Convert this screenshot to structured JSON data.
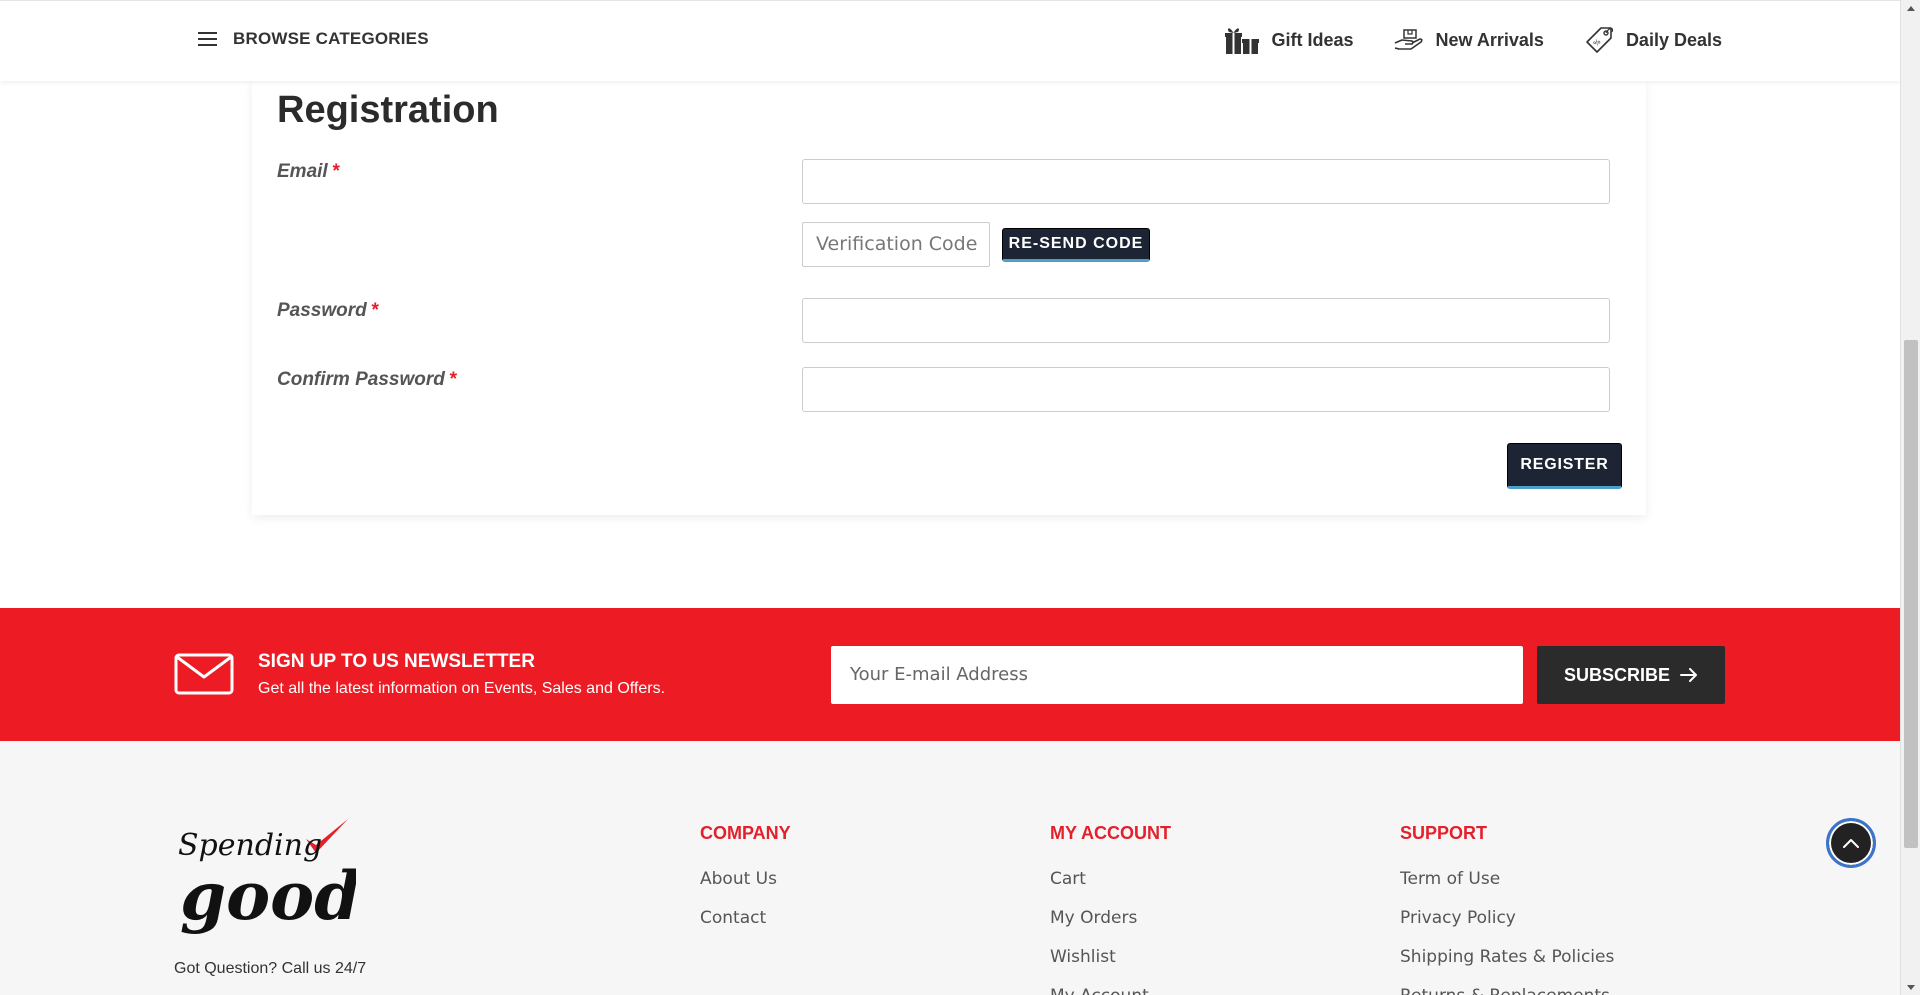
{
  "nav": {
    "browse_label": "BROWSE CATEGORIES",
    "links": [
      {
        "label": "Gift Ideas",
        "icon": "gift-icon"
      },
      {
        "label": "New Arrivals",
        "icon": "hand-package-icon"
      },
      {
        "label": "Daily Deals",
        "icon": "price-tag-icon"
      }
    ]
  },
  "registration": {
    "title": "Registration",
    "required_mark": "*",
    "email_label": "Email",
    "email_value": "",
    "verification_placeholder": "Verification Code",
    "resend_label": "RE-SEND CODE",
    "password_label": "Password",
    "password_value": "",
    "confirm_label": "Confirm Password",
    "confirm_value": "",
    "register_label": "REGISTER"
  },
  "newsletter": {
    "title": "SIGN UP TO US NEWSLETTER",
    "subtitle": "Get all the latest information on Events, Sales and Offers.",
    "input_placeholder": "Your E-mail Address",
    "button_label": "SUBSCRIBE"
  },
  "footer": {
    "logo_alt": "Spending good",
    "callus": "Got Question? Call us 24/7",
    "columns": [
      {
        "heading": "COMPANY",
        "links": [
          "About Us",
          "Contact"
        ]
      },
      {
        "heading": "MY ACCOUNT",
        "links": [
          "Cart",
          "My Orders",
          "Wishlist",
          "My Account"
        ]
      },
      {
        "heading": "SUPPORT",
        "links": [
          "Term of Use",
          "Privacy Policy",
          "Shipping Rates & Policies",
          "Returns & Replacements"
        ]
      }
    ]
  },
  "colors": {
    "brand_red": "#ed1c24",
    "dark_button": "#1d2433",
    "button_accent": "#4aa0c7"
  }
}
